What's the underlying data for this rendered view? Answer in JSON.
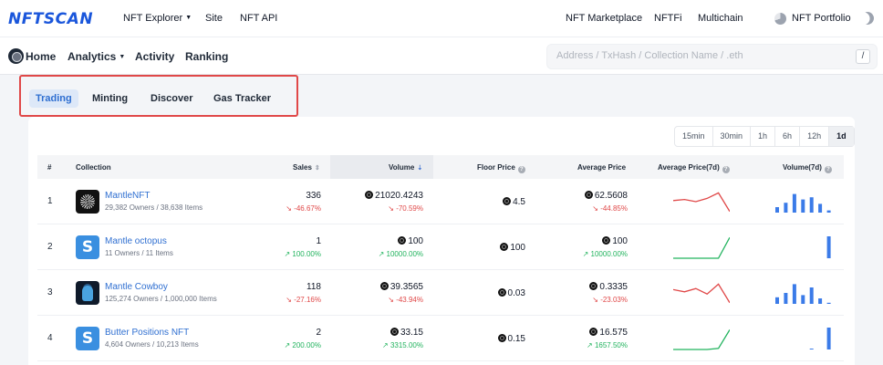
{
  "topbar": {
    "logo": "NFTSCAN",
    "nav": [
      "NFT Explorer",
      "Site",
      "NFT API"
    ],
    "right_nav": [
      "NFT Marketplace",
      "NFTFi",
      "Multichain"
    ],
    "portfolio": "NFT Portfolio"
  },
  "subnav": {
    "home": "Home",
    "analytics": "Analytics",
    "activity": "Activity",
    "ranking": "Ranking",
    "search_placeholder": "Address / TxHash / Collection Name / .eth",
    "search_shortcut": "/"
  },
  "tabs": [
    "Trading",
    "Minting",
    "Discover",
    "Gas Tracker"
  ],
  "active_tab": "Trading",
  "timeframes": [
    "15min",
    "30min",
    "1h",
    "6h",
    "12h",
    "1d"
  ],
  "active_timeframe": "1d",
  "table": {
    "headers": {
      "rank": "#",
      "collection": "Collection",
      "sales": "Sales",
      "volume": "Volume",
      "floor": "Floor Price",
      "avg": "Average Price",
      "avg7d": "Average Price(7d)",
      "vol7d": "Volume(7d)"
    },
    "rows": [
      {
        "rank": "1",
        "name": "MantleNFT",
        "meta": "29,382 Owners / 38,638 Items",
        "sales": "336",
        "sales_chg": "↘ -46.67%",
        "volume": "21020.4243",
        "volume_chg": "↘ -70.59%",
        "floor": "4.5",
        "avg": "62.5608",
        "avg_chg": "↘ -44.85%",
        "trend": "down",
        "spark": [
          0.45,
          0.4,
          0.5,
          0.35,
          0.1,
          0.95
        ],
        "bars": [
          0.25,
          0.45,
          0.85,
          0.6,
          0.7,
          0.4,
          0.1
        ]
      },
      {
        "rank": "2",
        "name": "Mantle octopus",
        "meta": "11 Owners / 11 Items",
        "sales": "1",
        "sales_chg": "↗ 100.00%",
        "volume": "100",
        "volume_chg": "↗ 10000.00%",
        "floor": "100",
        "avg": "100",
        "avg_chg": "↗ 10000.00%",
        "trend": "up",
        "spark": [
          1,
          1,
          1,
          1,
          1,
          0.05
        ],
        "bars": [
          0,
          0,
          0,
          0,
          0,
          0,
          1
        ]
      },
      {
        "rank": "3",
        "name": "Mantle Cowboy",
        "meta": "125,274 Owners / 1,000,000 Items",
        "sales": "118",
        "sales_chg": "↘ -27.16%",
        "volume": "39.3565",
        "volume_chg": "↘ -43.94%",
        "floor": "0.03",
        "avg": "0.3335",
        "avg_chg": "↘ -23.03%",
        "trend": "down",
        "spark": [
          0.35,
          0.45,
          0.3,
          0.55,
          0.1,
          0.95
        ],
        "bars": [
          0.3,
          0.5,
          0.9,
          0.4,
          0.75,
          0.25,
          0.05
        ]
      },
      {
        "rank": "4",
        "name": "Butter Positions NFT",
        "meta": "4,604 Owners / 10,213 Items",
        "sales": "2",
        "sales_chg": "↗ 200.00%",
        "volume": "33.15",
        "volume_chg": "↗ 3315.00%",
        "floor": "0.15",
        "avg": "16.575",
        "avg_chg": "↗ 1657.50%",
        "trend": "up",
        "spark": [
          1,
          1,
          1,
          1,
          0.95,
          0.1
        ],
        "bars": [
          0,
          0,
          0,
          0,
          0.02,
          0,
          1
        ]
      }
    ]
  },
  "colors": {
    "accent": "#2f6fd1",
    "down": "#e04848",
    "up": "#22b35e",
    "bar": "#3b7be8",
    "highlight_box": "#e04848"
  }
}
